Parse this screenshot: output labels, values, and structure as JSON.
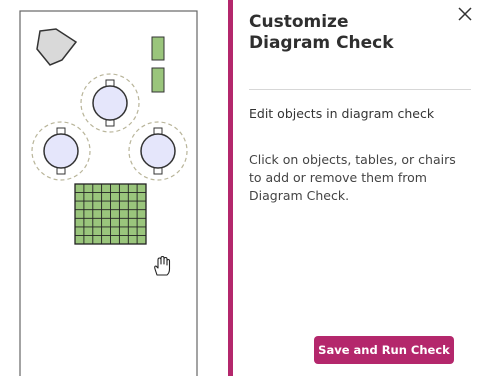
{
  "panel": {
    "title": "Customize Diagram Check",
    "subtitle": "Edit objects in diagram check",
    "description": "Click on objects, tables, or chairs to add or remove them from Diagram Check.",
    "save_button_label": "Save and Run Check"
  },
  "icons": {
    "close": "close-icon",
    "cursor": "hand-cursor-icon"
  },
  "colors": {
    "accent": "#b4276c",
    "table_fill": "#e5e6fb",
    "object_fill": "#9ac57c",
    "clearance_ring": "#b9b59a"
  }
}
